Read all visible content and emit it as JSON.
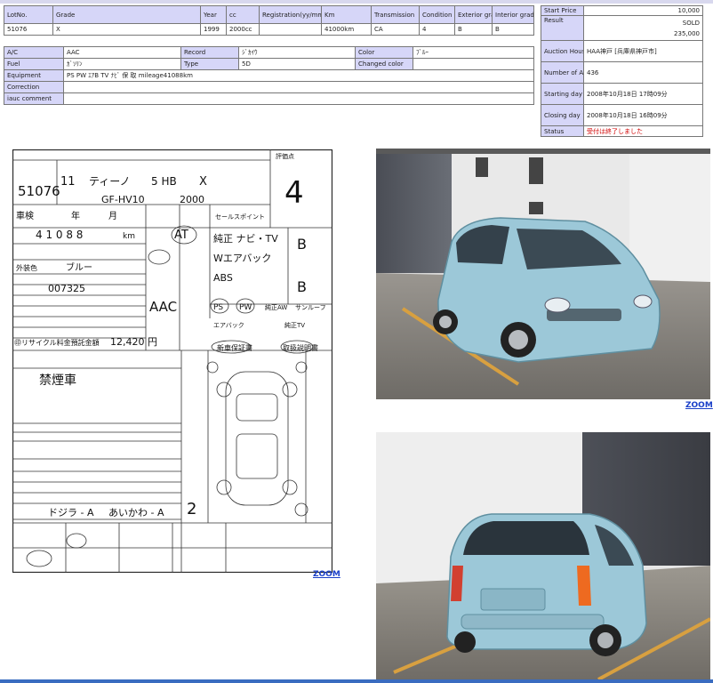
{
  "main_table": {
    "headers": [
      "LotNo.",
      "Grade",
      "Year",
      "cc",
      "Registration(yy/mm)",
      "Km",
      "Transmission",
      "Condition",
      "Exterior grade",
      "Interior grade"
    ],
    "values": [
      "51076",
      "X",
      "1999",
      "2000cc",
      "",
      "41000km",
      "CA",
      "4",
      "B",
      "B"
    ]
  },
  "details": {
    "ac_label": "A/C",
    "ac_value": "AAC",
    "record_label": "Record",
    "record_value": "ｼﾞｶｲｳ",
    "color_label": "Color",
    "color_value": "ﾌﾞﾙｰ",
    "fuel_label": "Fuel",
    "fuel_value": "ｶﾞｿﾘﾝ",
    "type_label": "Type",
    "type_value": "5D",
    "changed_color_label": "Changed color",
    "changed_color_value": "",
    "equipment_label": "Equipment",
    "equipment_value": "PS PW ｴｱB TV ﾅﾋﾞ 保 取 mileage41088km",
    "correction_label": "Correction",
    "correction_value": "",
    "comment_label": "iauc comment",
    "comment_value": ""
  },
  "auction": {
    "start_price_label": "Start Price",
    "start_price": "10,000",
    "result_label": "Result",
    "result_status": "SOLD",
    "result_price": "235,000",
    "house_label": "Auction House",
    "house_value": "HAA神戸 [兵庫県神戸市]",
    "number_label": "Number of Auction",
    "number_value": "436",
    "starting_label": "Starting day",
    "starting_value": "2008年10月18日 17時09分",
    "closing_label": "Closing day",
    "closing_value": "2008年10月18日 16時09分",
    "status_label": "Status",
    "status_value": "受付は終了しました"
  },
  "sheet": {
    "lot": "51076",
    "year": "11",
    "model": "ティーノ",
    "shape": "5 HB",
    "grade": "X",
    "chassis": "GF-HV10",
    "cc": "2000",
    "score": "4",
    "shaken_label": "車検",
    "nen": "年",
    "tsuki": "月",
    "mileage": "4 1 0 8 8",
    "km": "km",
    "color_label": "外装色",
    "color": "ブルー",
    "frame": "007325",
    "ac": "AAC",
    "at": "AT",
    "notes1": "純正 ナビ・TV",
    "notes2": "Wエアバック",
    "notes3": "ABS",
    "recycle_label": "㊞リサイクル料金預託金額",
    "recycle": "12,420 円",
    "remark": "禁煙車",
    "inspector": "ドジラ - A",
    "inspector2": "あいかわ - A",
    "interior": "2",
    "sale_point_label": "セールスポイント",
    "score_label": "評価点",
    "grade_b": "B",
    "warranty": "新車保証書",
    "manual": "取扱説明書",
    "ps": "PS",
    "pw": "PW",
    "aw": "純正AW",
    "sunroof": "サンルーフ",
    "airbag": "エアバック",
    "tv": "純正TV"
  },
  "photos": [
    {
      "zoom": "ZOOM"
    },
    {
      "zoom": ""
    }
  ],
  "sheet_zoom": "ZOOM",
  "colors": {
    "header_bg": "#d6d6f8",
    "car_body": "#9cc8d8",
    "link": "#1a3fc8",
    "status_red": "#d00000"
  }
}
